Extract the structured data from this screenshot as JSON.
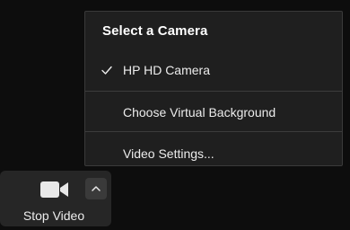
{
  "camera_menu": {
    "header": "Select a Camera",
    "items": [
      {
        "label": "HP HD Camera",
        "checked": true,
        "icon": "check-icon"
      },
      {
        "label": "Choose Virtual Background"
      },
      {
        "label": "Video Settings..."
      }
    ]
  },
  "toolbar": {
    "video_label": "Stop Video",
    "video_icon": "video-camera-icon",
    "options_icon": "chevron-up-icon"
  },
  "colors": {
    "background": "#0d0d0d",
    "menu_background": "#1f1f1f",
    "toolbar_background": "#262626",
    "text": "#ececec"
  }
}
